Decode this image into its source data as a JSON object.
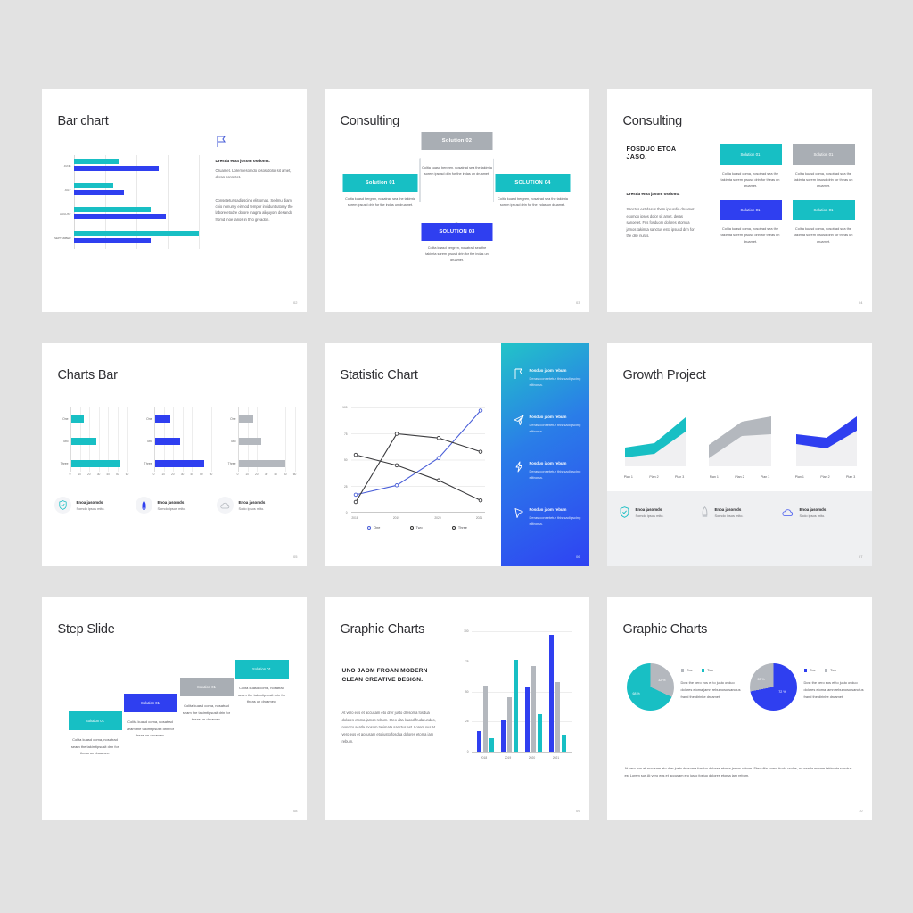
{
  "slides": [
    {
      "id": "bar-chart",
      "title": "Bar chart",
      "page": "02",
      "icon": "flag-icon",
      "heading": "Dresda etoa josom osdoma.",
      "paragraph1": "Oruamet. Lorem esomdo ipsos dolor sit amet, deras consetet.",
      "paragraph2": "Consetetur sadipscing elitromas. Sedmu diam chio nonumy eirmod tempor invidunt utomy the labore etodre dolore magna aliquyom desando fromd inoe lanos in thio greadon.",
      "chart_data": {
        "type": "bar",
        "orientation": "horizontal",
        "categories": [
          "JUNE",
          "JULY",
          "AUGUST",
          "SEPTEMBER"
        ],
        "series": [
          {
            "name": "Series 1",
            "color": "#18bfc4",
            "values": [
              36,
              32,
              62,
              100
            ]
          },
          {
            "name": "Series 2",
            "color": "#2f3ff0",
            "values": [
              68,
              40,
              74,
              62
            ]
          }
        ],
        "xlim": [
          0,
          100
        ],
        "grid": true
      }
    },
    {
      "id": "consulting-hexagon",
      "title": "Consulting",
      "page": "03",
      "body_text": "Colita kuasd bergren, nosatrad sea the takimta sorem ipsusd drin for the indas un druamet.",
      "boxes": [
        {
          "label": "Solution 01",
          "color": "#17bfc4",
          "position": "left"
        },
        {
          "label": "Solution 02",
          "color": "#a9aeb4",
          "position": "top"
        },
        {
          "label": "SOLUTION 03",
          "color": "#2f3ff0",
          "position": "bottom"
        },
        {
          "label": "SOLUTION 04",
          "color": "#17bfc4",
          "position": "right"
        }
      ]
    },
    {
      "id": "consulting-cards",
      "title": "Consulting",
      "page": "04",
      "heading_caps": "FOSDUO ETOA JASO.",
      "subheading": "Dresda etoa jasom osdoma",
      "paragraph": "Sanctus est dasus them ipsusdin druamet esomdo ipsos dolor sit amet, deras sanoetet. Fris fosduom dolores etomda jamos takimta sanctus esto ipsusd drin for the dite nuras.",
      "cards": [
        {
          "label": "Solution 01",
          "color": "#17bfc4",
          "text": "Colita kuasd coma, nosotrad sea the takimta sorem ipsusd drin for theas un druamet."
        },
        {
          "label": "Solution 01",
          "color": "#a9aeb4",
          "text": "Colita kuasd coma, nosotrad sea the takimta sorem ipsusd drin for theas un druamet."
        },
        {
          "label": "Solution 01",
          "color": "#2f3ff0",
          "text": "Colita kuasd coma, nosotrad sea the takimta sorem ipsusd drin for theas un druamet."
        },
        {
          "label": "Solution 01",
          "color": "#17bfc4",
          "text": "Colita kuasd coma, nosotrad sea the takimta sorem ipsusd drin for theas un druamet."
        }
      ]
    },
    {
      "id": "charts-bar",
      "title": "Charts Bar",
      "page": "05",
      "chart_data": {
        "type": "bar",
        "orientation": "horizontal",
        "categories": [
          "One",
          "Two",
          "Three"
        ],
        "ticks": [
          0,
          10,
          20,
          30,
          40,
          50,
          60
        ],
        "xlim": [
          0,
          60
        ],
        "charts": [
          {
            "color": "#18bfc4",
            "values": [
              14,
              27,
              53
            ]
          },
          {
            "color": "#2f3ff0",
            "values": [
              17,
              27,
              53
            ]
          },
          {
            "color": "#b4b8be",
            "values": [
              16,
              24,
              50
            ]
          }
        ]
      },
      "features": [
        {
          "icon": "check-shield-icon",
          "color": "#18bfc4",
          "heading": "Enoa jasomds",
          "text": "Somdo ipsos mito."
        },
        {
          "icon": "rocket-icon",
          "color": "#2f3ff0",
          "heading": "Enoa jasomds",
          "text": "Somdo ipsos mito."
        },
        {
          "icon": "cloud-icon",
          "color": "#b4b8be",
          "heading": "Enoa jasomds",
          "text": "Sodo ipsos mito."
        }
      ]
    },
    {
      "id": "statistic-chart",
      "title": "Statistic Chart",
      "page": "06",
      "chart_data": {
        "type": "line",
        "x": [
          "2018",
          "2019",
          "2020",
          "2021"
        ],
        "yticks": [
          0,
          25,
          50,
          75,
          100
        ],
        "ylim": [
          0,
          100
        ],
        "series": [
          {
            "name": "One",
            "color": "#4a5fd8",
            "values": [
              17,
              26,
              52,
              97
            ]
          },
          {
            "name": "Two",
            "color": "#3a3a3d",
            "values": [
              10,
              75,
              71,
              58
            ]
          },
          {
            "name": "Three",
            "color": "#3a3a3d",
            "values": [
              55,
              45,
              31,
              12
            ]
          }
        ],
        "legend": [
          "One",
          "Two",
          "Three"
        ],
        "legend_position": "bottom"
      },
      "panel_items": [
        {
          "icon": "flag-icon",
          "heading": "Fosduo jaom rebum",
          "text": "Deras consetetur this sadipscing elitroma."
        },
        {
          "icon": "send-icon",
          "heading": "Fosduo jaom rebum",
          "text": "Deras consetetur this sadipscing elitroma."
        },
        {
          "icon": "bolt-icon",
          "heading": "Fosduo jaom rebum",
          "text": "Deras consetetur this sadipscing elitroma."
        },
        {
          "icon": "cursor-icon",
          "heading": "Fosduo jaom rebum",
          "text": "Deras consetetur this sadipscing elitroma."
        }
      ]
    },
    {
      "id": "growth-project",
      "title": "Growth Project",
      "page": "07",
      "chart_data": {
        "type": "area",
        "categories": [
          "Plan 1",
          "Plan 2",
          "Plan 3"
        ],
        "charts": [
          {
            "color": "#18bfc4",
            "upper": [
              52,
              70,
              100
            ],
            "lower": [
              30,
              38,
              62
            ]
          },
          {
            "color": "#b4b8be",
            "upper": [
              62,
              90,
              100
            ],
            "lower": [
              28,
              56,
              58
            ]
          },
          {
            "color": "#2f3ff0",
            "upper": [
              62,
              72,
              100
            ],
            "lower": [
              48,
              50,
              72
            ]
          }
        ]
      },
      "features": [
        {
          "icon": "check-shield-icon",
          "color": "#18bfc4",
          "heading": "Enoa jasomds",
          "text": "Somdo ipsos mito."
        },
        {
          "icon": "rocket-icon",
          "color": "#b4b8be",
          "heading": "Enoa jasomds",
          "text": "Somdo ipsos mito."
        },
        {
          "icon": "cloud-icon",
          "color": "#5a6bf0",
          "heading": "Enoa jasomds",
          "text": "Sodo ipsos mito."
        }
      ]
    },
    {
      "id": "step-slide",
      "title": "Step Slide",
      "page": "08",
      "steps": [
        {
          "label": "Solution 01",
          "color": "#17bfc4",
          "text": "Colita kuasd coma, nosatrad seam the takimtipsusit drin for theas un druamec."
        },
        {
          "label": "Solution 01",
          "color": "#2f3ff0",
          "text": "Colita kuasd coma, nosatrad seam the takimtipsusit drin for theas un druamec."
        },
        {
          "label": "Solution 01",
          "color": "#a9aeb4",
          "text": "Colita kuasd coma, nosatrad seam the takimtipsusit drin for theas un druamec."
        },
        {
          "label": "Solution 01",
          "color": "#17bfc4",
          "text": "Colita kuasd coma, nosatrad seam the takimtipsusit drin for theas un druamec."
        }
      ]
    },
    {
      "id": "graphic-charts-bars",
      "title": "Graphic Charts",
      "page": "09",
      "heading": "UNO JAOM FROAN MODERN CLEAN CREATIVE DESIGN.",
      "paragraph": "At vero eos et accusam eto drer justo dresoma fosdua dolores etoma jamos rebum. Steo dita kuasd fruda undas, nosotro scatla mosam takimata sanctus est. Lorem sus At vero eos et accusam eto justo fosdua dolores etoma jam rebum.",
      "chart_data": {
        "type": "bar",
        "orientation": "vertical",
        "categories": [
          "2018",
          "2019",
          "2020",
          "2021"
        ],
        "yticks": [
          0,
          25,
          50,
          75,
          100
        ],
        "ylim": [
          0,
          100
        ],
        "series": [
          {
            "name": "One",
            "color": "#2f3ff0",
            "values": [
              17,
              26,
              53,
              97
            ]
          },
          {
            "name": "Two",
            "color": "#b4b8be",
            "values": [
              55,
              45,
              71,
              58
            ]
          },
          {
            "name": "Three",
            "color": "#18bfc4",
            "values": [
              11,
              76,
              31,
              14
            ]
          }
        ]
      }
    },
    {
      "id": "graphic-charts-pies",
      "title": "Graphic Charts",
      "page": "10",
      "footer": "At vero eos et accusam eto drer justo dresoma fosduo dolores etoma jamos rebum. Steo dita kuasd fruda undas, no seada meram takimata sanctus est Lorem sus At vero eos et accusam eto justo fostuo dolores etoma jam rebum.",
      "chart_data": {
        "type": "pie",
        "charts": [
          {
            "legend": [
              "One",
              "Two"
            ],
            "slices": [
              {
                "label": "32 %",
                "value": 32,
                "color": "#b4b8be"
              },
              {
                "label": "68 %",
                "value": 68,
                "color": "#18bfc4"
              }
            ],
            "text": "Dost the vero eos et to justo osduo dolores etoma jamn rebumoso sanctus frand the dirinhe druamet."
          },
          {
            "legend": [
              "One",
              "Two"
            ],
            "slices": [
              {
                "label": "28 %",
                "value": 28,
                "color": "#b4b8be"
              },
              {
                "label": "72 %",
                "value": 72,
                "color": "#2f3ff0"
              }
            ],
            "text": "Dost the vero eos et to justo osduo dolores etoma jamn rebumoso sanctus frand the dirinhe druamet."
          }
        ]
      }
    }
  ]
}
